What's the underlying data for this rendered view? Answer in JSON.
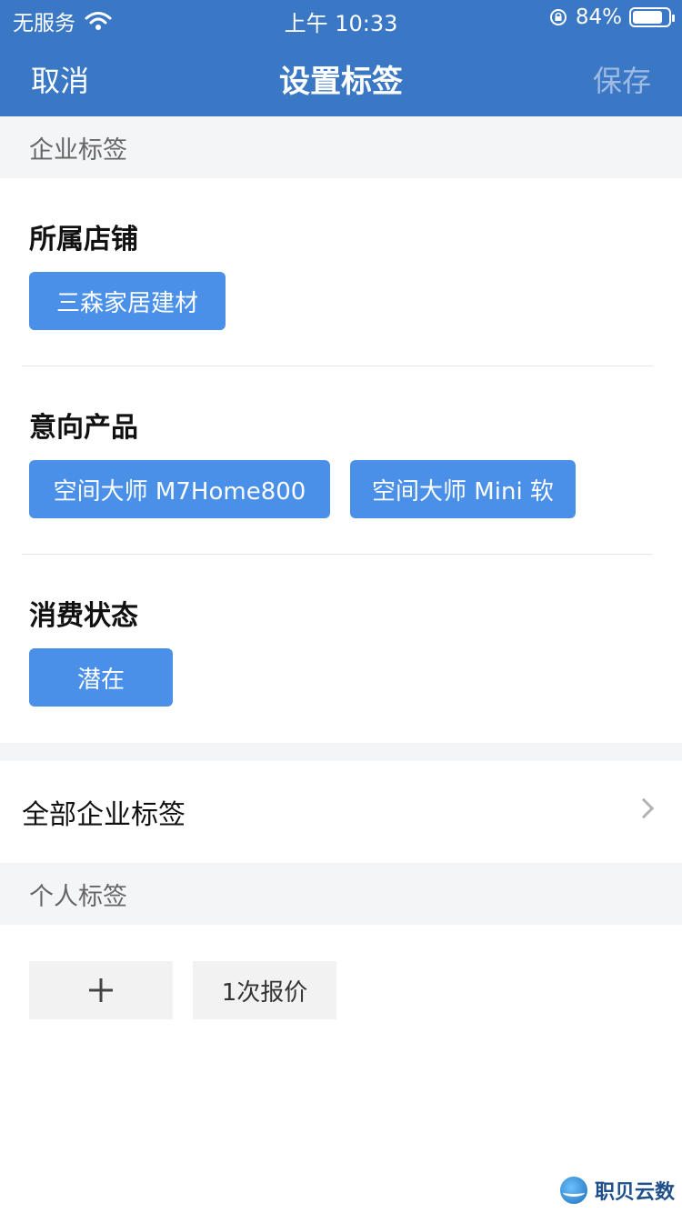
{
  "status_bar": {
    "carrier": "无服务",
    "time": "上午 10:33",
    "battery_text": "84%",
    "battery_level": 0.84,
    "icons": [
      "wifi-icon",
      "orientation-lock-icon",
      "battery-icon"
    ]
  },
  "nav": {
    "cancel": "取消",
    "title": "设置标签",
    "save": "保存"
  },
  "enterprise": {
    "header": "企业标签",
    "groups": [
      {
        "title": "所属店铺",
        "tags": [
          "三森家居建材"
        ]
      },
      {
        "title": "意向产品",
        "tags": [
          "空间大师 M7Home800",
          "空间大师 Mini 软"
        ]
      },
      {
        "title": "消费状态",
        "tags": [
          "潜在"
        ]
      }
    ],
    "all_label": "全部企业标签"
  },
  "personal": {
    "header": "个人标签",
    "add_symbol": "+",
    "tags": [
      "1次报价"
    ]
  },
  "watermark": {
    "text": "职贝云数"
  },
  "colors": {
    "nav_bg": "#3a78c5",
    "tag_bg": "#4a90e9",
    "save_disabled": "#9fbbe4",
    "section_bg": "#f4f5f7"
  }
}
